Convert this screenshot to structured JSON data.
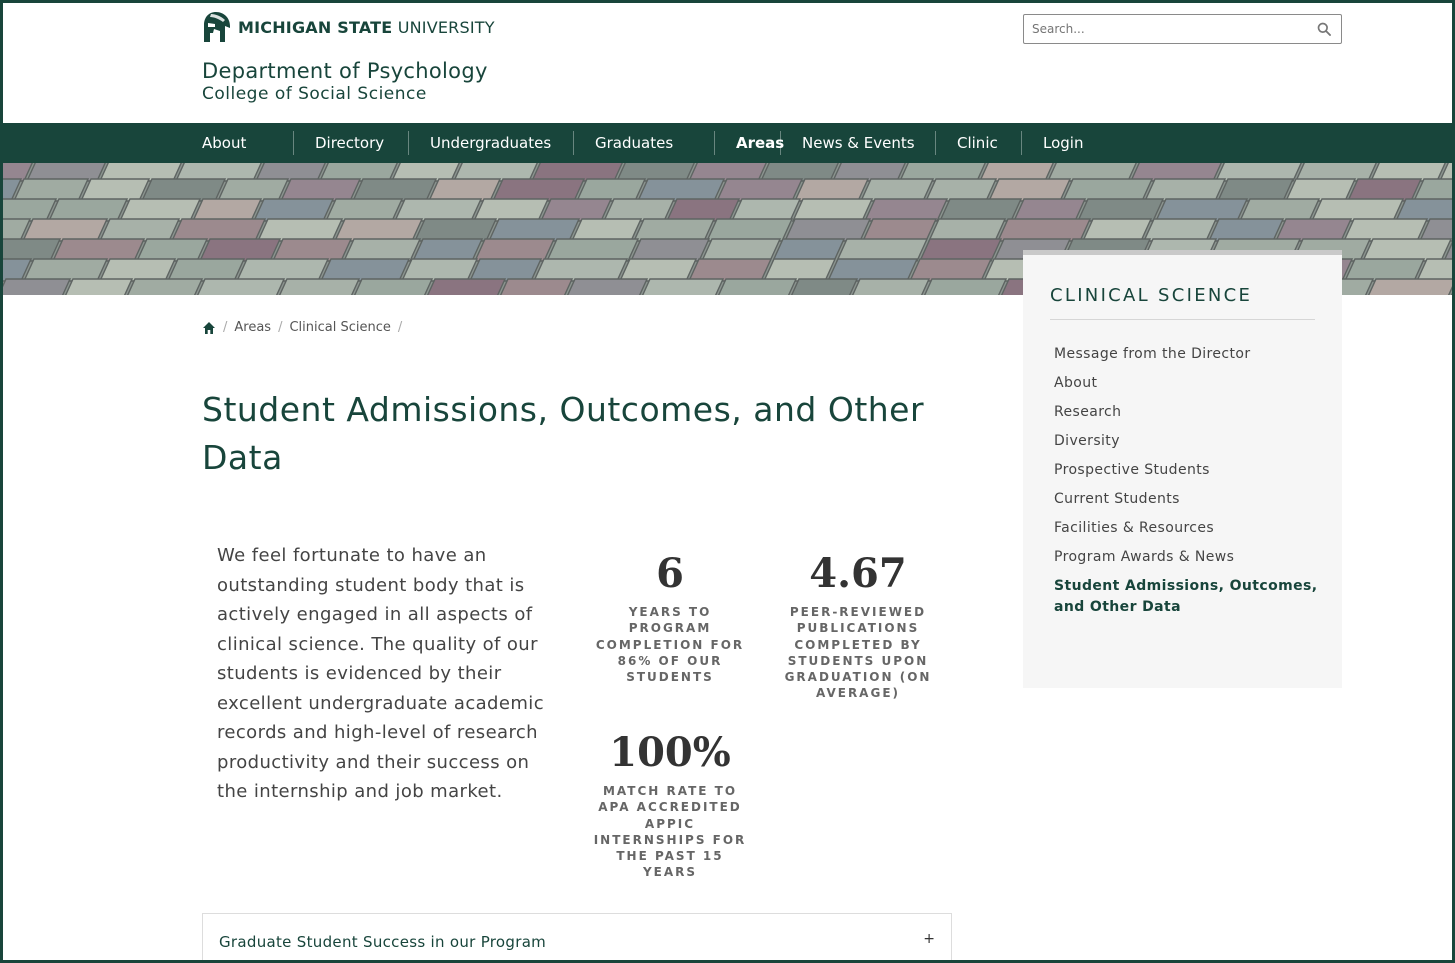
{
  "header": {
    "logo_bold": "MICHIGAN STATE",
    "logo_light": "UNIVERSITY",
    "department": "Department of Psychology",
    "college": "College of Social Science",
    "search_placeholder": "Search..."
  },
  "nav": {
    "items": [
      {
        "label": "About"
      },
      {
        "label": "Directory"
      },
      {
        "label": "Undergraduates"
      },
      {
        "label": "Graduates"
      },
      {
        "label": "Areas",
        "active": true
      },
      {
        "label": "News & Events"
      },
      {
        "label": "Clinic"
      },
      {
        "label": "Login"
      }
    ]
  },
  "breadcrumb": {
    "home_icon": "home-icon",
    "items": [
      "Areas",
      "Clinical Science"
    ],
    "separator": "/"
  },
  "main": {
    "title": "Student Admissions, Outcomes, and Other Data",
    "intro": "We feel fortunate to have an outstanding student body that is actively engaged in all aspects of clinical science. The quality of our students is evidenced by their excellent undergraduate academic records and high-level of research productivity and their success on the internship and job market.",
    "stats": [
      {
        "value": "6",
        "description": "Years to program completion for 86% of our students"
      },
      {
        "value": "4.67",
        "description": "Peer-reviewed publications completed by students upon graduation (on average)"
      },
      {
        "value": "100%",
        "description": "Match rate to APA accredited APPIC internships for the past 15 years"
      }
    ],
    "accordion": {
      "label": "Graduate Student Success in our Program",
      "toggle": "+"
    }
  },
  "sidebar": {
    "title": "CLINICAL SCIENCE",
    "items": [
      {
        "label": "Message from the Director"
      },
      {
        "label": "About"
      },
      {
        "label": "Research"
      },
      {
        "label": "Diversity"
      },
      {
        "label": "Prospective Students"
      },
      {
        "label": "Current Students"
      },
      {
        "label": "Facilities & Resources"
      },
      {
        "label": "Program Awards & News"
      },
      {
        "label": "Student Admissions, Outcomes, and Other Data",
        "current": true
      }
    ]
  },
  "colors": {
    "brand_green": "#18453b",
    "background": "#ffffff",
    "sidebar_bg": "#f6f6f6"
  }
}
